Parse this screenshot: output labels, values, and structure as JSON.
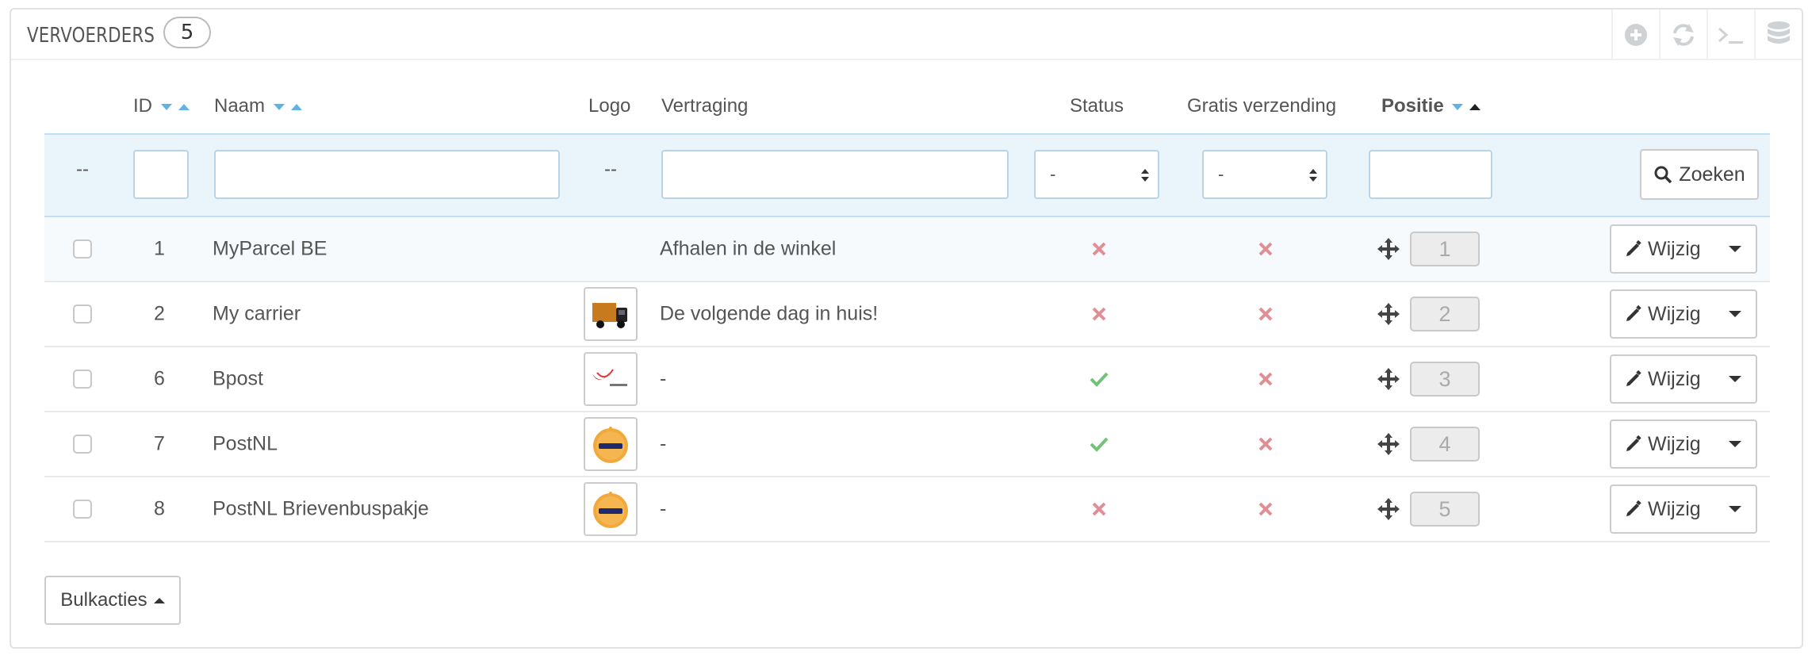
{
  "panel": {
    "title": "VERVOERDERS",
    "count": "5",
    "toolbar_icons": [
      "add-icon",
      "refresh-icon",
      "terminal-icon",
      "database-icon"
    ]
  },
  "columns": {
    "id": "ID",
    "name": "Naam",
    "logo": "Logo",
    "delay": "Vertraging",
    "status": "Status",
    "free_shipping": "Gratis verzending",
    "position": "Positie"
  },
  "filters": {
    "id_placeholder": "--",
    "logo_placeholder": "--",
    "status_value": "-",
    "free_shipping_value": "-",
    "search_label": "Zoeken"
  },
  "rows": [
    {
      "id": "1",
      "name": "MyParcel BE",
      "delay": "Afhalen in de winkel",
      "logo": "",
      "status": false,
      "free": false,
      "position": "1"
    },
    {
      "id": "2",
      "name": "My carrier",
      "delay": "De volgende dag in huis!",
      "logo": "truck",
      "status": false,
      "free": false,
      "position": "2"
    },
    {
      "id": "6",
      "name": "Bpost",
      "delay": "-",
      "logo": "bpost",
      "status": true,
      "free": false,
      "position": "3"
    },
    {
      "id": "7",
      "name": "PostNL",
      "delay": "-",
      "logo": "postnl",
      "status": true,
      "free": false,
      "position": "4"
    },
    {
      "id": "8",
      "name": "PostNL Brievenbuspakje",
      "delay": "-",
      "logo": "postnl",
      "status": false,
      "free": false,
      "position": "5"
    }
  ],
  "row_actions": {
    "edit_label": "Wijzig"
  },
  "bulk": {
    "label": "Bulkacties"
  },
  "colors": {
    "accent": "#25b9d7",
    "sort_arrow": "#5fb4e4",
    "enabled": "#72c279",
    "disabled": "#e08f95",
    "filter_bg": "#eaf4fb"
  }
}
